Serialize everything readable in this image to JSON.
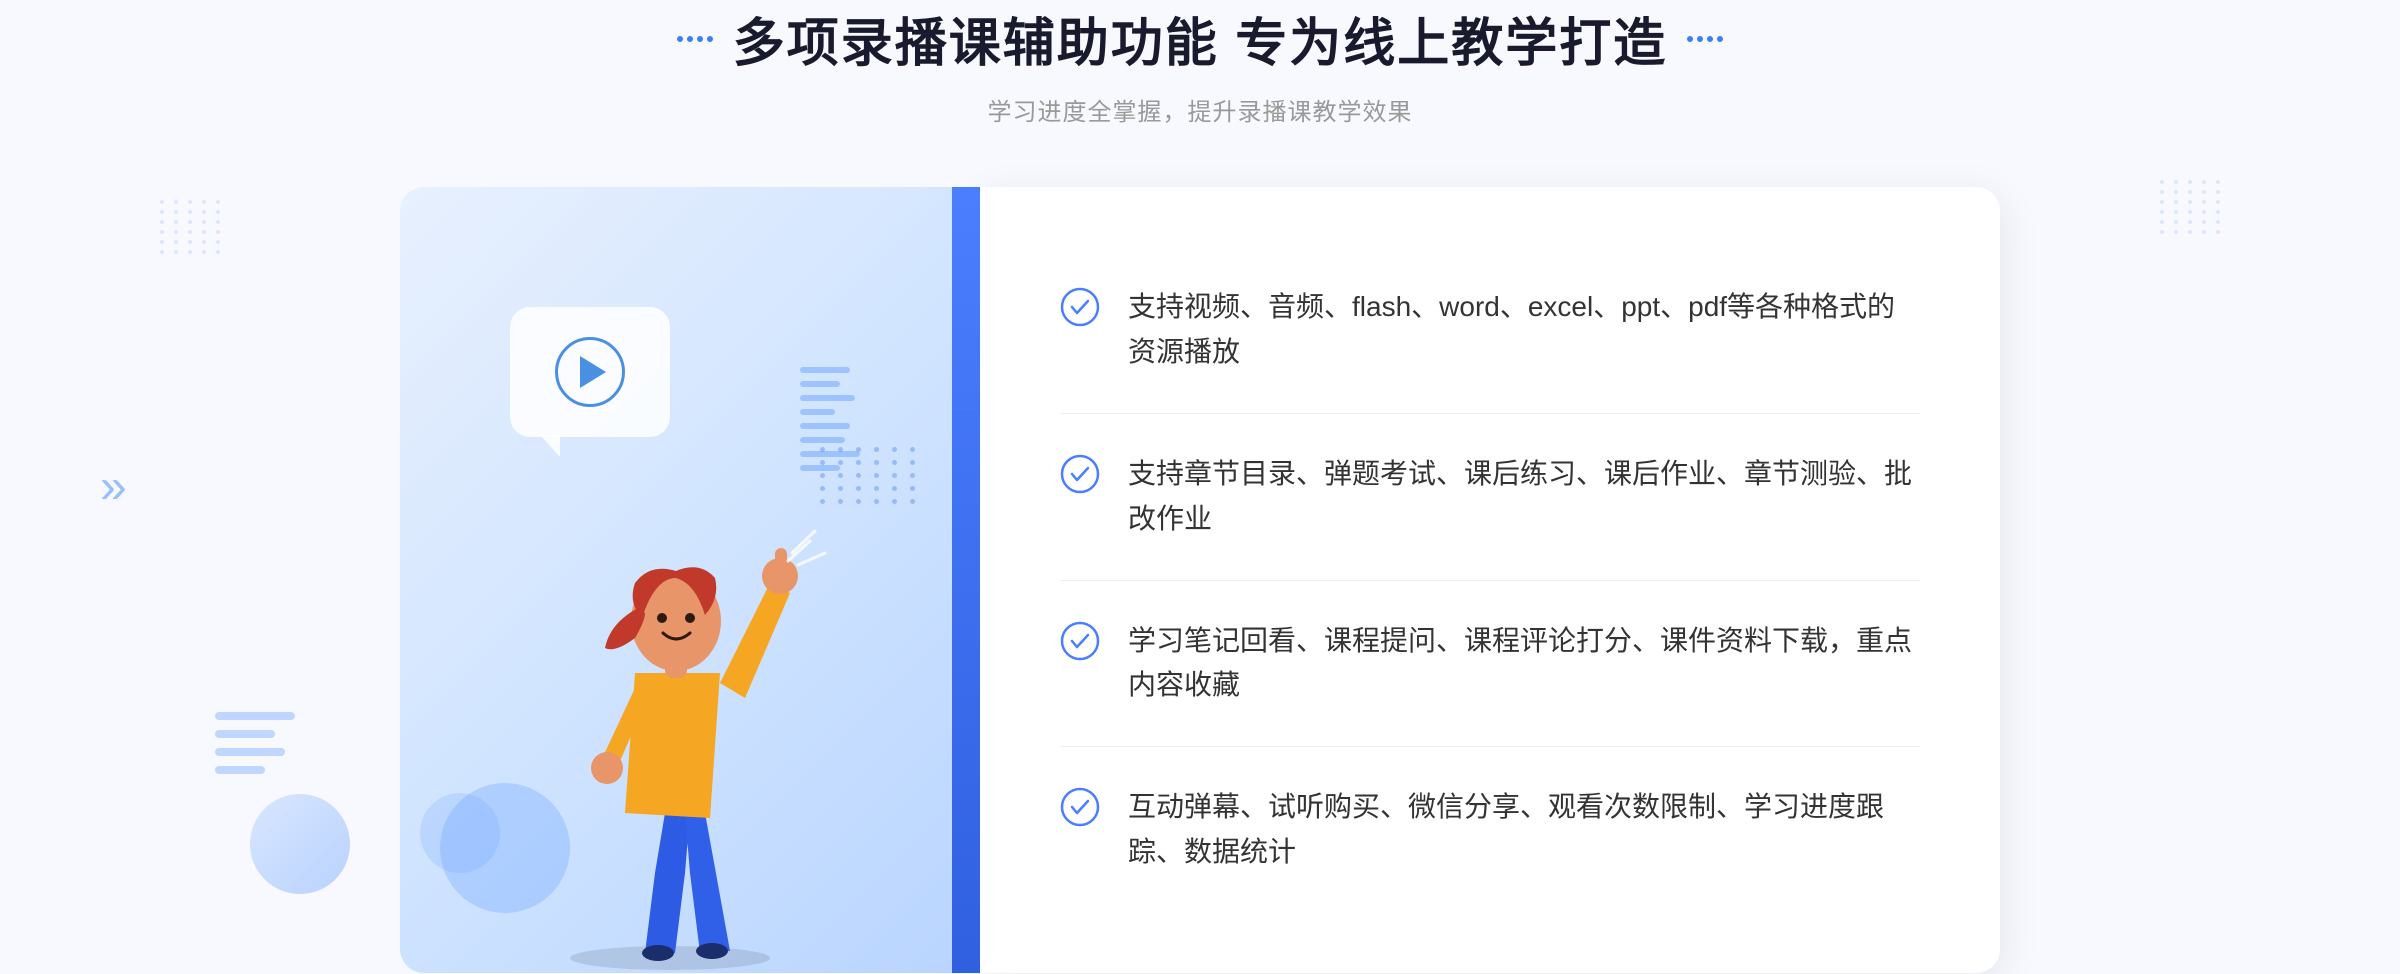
{
  "header": {
    "title": "多项录播课辅助功能 专为线上教学打造",
    "subtitle": "学习进度全掌握，提升录播课教学效果",
    "title_deco_left": "decorative-dots-left",
    "title_deco_right": "decorative-dots-right"
  },
  "features": [
    {
      "id": 1,
      "text": "支持视频、音频、flash、word、excel、ppt、pdf等各种格式的资源播放"
    },
    {
      "id": 2,
      "text": "支持章节目录、弹题考试、课后练习、课后作业、章节测验、批改作业"
    },
    {
      "id": 3,
      "text": "学习笔记回看、课程提问、课程评论打分、课件资料下载，重点内容收藏"
    },
    {
      "id": 4,
      "text": "互动弹幕、试听购买、微信分享、观看次数限制、学习进度跟踪、数据统计"
    }
  ],
  "colors": {
    "primary": "#4a7eff",
    "text_dark": "#1a1a2e",
    "text_light": "#999999",
    "text_body": "#333333",
    "check_color": "#4a7eff",
    "bg_light": "#f8f9ff",
    "panel_bg": "#ffffff"
  },
  "icons": {
    "check": "check-circle-icon",
    "play": "play-icon",
    "arrow_left": "chevron-double-left-icon"
  }
}
